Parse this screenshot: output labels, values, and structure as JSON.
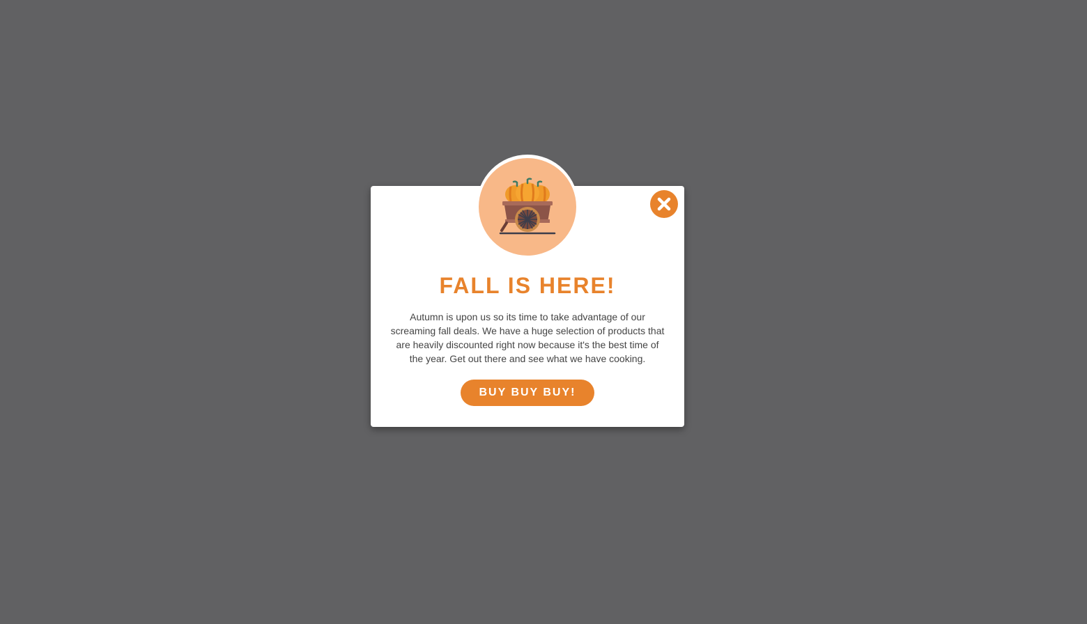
{
  "popup": {
    "title": "FALL IS HERE!",
    "message": "Autumn is upon us so its time to take advantage of our screaming fall deals. We have a huge selection of products that are heavily discounted right now because it's the best time of the year. Get out there and see what we have cooking.",
    "cta_label": "BUY BUY BUY!",
    "close_icon": "close-icon",
    "badge_icon": "pumpkin-cart-icon"
  },
  "colors": {
    "backdrop": "#616163",
    "accent": "#e8832c",
    "badge_bg": "#f8b888",
    "text": "#444444"
  }
}
